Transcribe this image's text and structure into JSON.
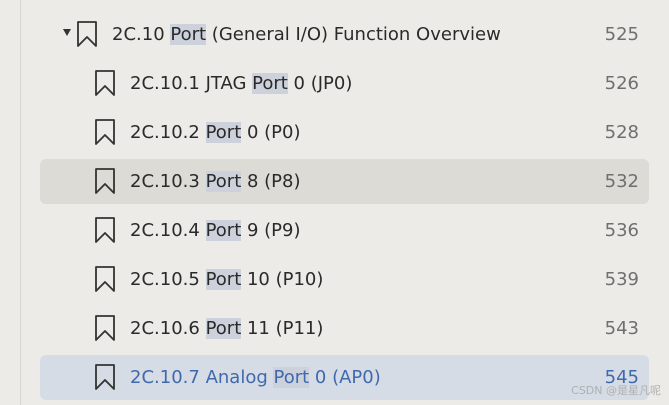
{
  "bookmark_icon": "bookmark-icon",
  "expand_icon": "caret-down-icon",
  "highlight_term": "Port",
  "items": [
    {
      "num": "2C.10",
      "before": "",
      "term": "Port",
      "after": " (General I/O) Function Overview",
      "page": "525",
      "expanded": true,
      "level": 0
    },
    {
      "num": "2C.10.1",
      "before": "JTAG ",
      "term": "Port",
      "after": " 0 (JP0)",
      "page": "526",
      "level": 1
    },
    {
      "num": "2C.10.2",
      "before": "",
      "term": "Port",
      "after": " 0 (P0)",
      "page": "528",
      "level": 1
    },
    {
      "num": "2C.10.3",
      "before": "",
      "term": "Port",
      "after": " 8 (P8)",
      "page": "532",
      "level": 1,
      "state": "hover"
    },
    {
      "num": "2C.10.4",
      "before": "",
      "term": "Port",
      "after": " 9 (P9)",
      "page": "536",
      "level": 1
    },
    {
      "num": "2C.10.5",
      "before": "",
      "term": "Port",
      "after": " 10 (P10)",
      "page": "539",
      "level": 1
    },
    {
      "num": "2C.10.6",
      "before": "",
      "term": "Port",
      "after": " 11 (P11)",
      "page": "543",
      "level": 1
    },
    {
      "num": "2C.10.7",
      "before": "Analog ",
      "term": "Port",
      "after": " 0 (AP0)",
      "page": "545",
      "level": 1,
      "state": "selected"
    }
  ],
  "watermark": "CSDN @是星凡呢"
}
